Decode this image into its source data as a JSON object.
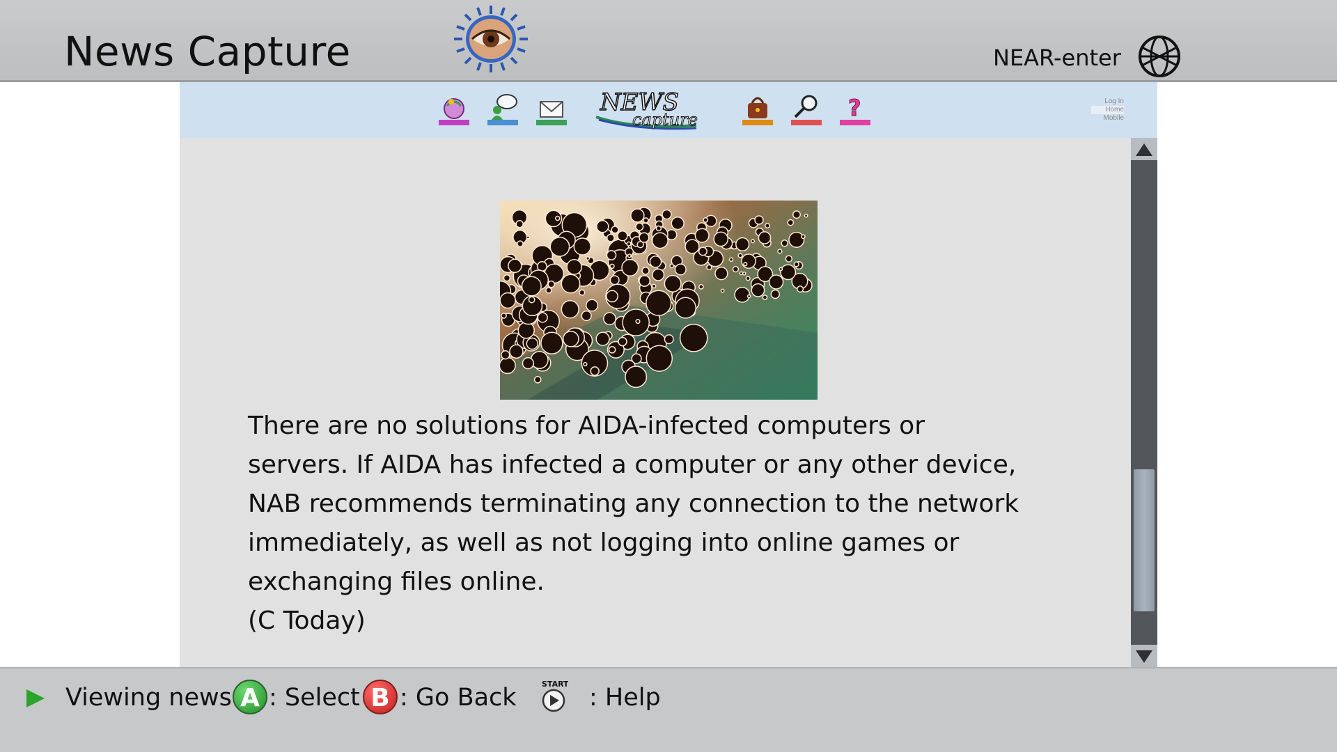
{
  "header": {
    "app_title": "News Capture",
    "mode_label": "NEAR-enter"
  },
  "toolbar": {
    "buttons": [
      {
        "name": "globe-person-icon",
        "color": "#c040c0"
      },
      {
        "name": "chat-icon",
        "color": "#4a8fd0"
      },
      {
        "name": "mail-icon",
        "color": "#3aa05a"
      },
      {
        "name": "bag-icon",
        "color": "#e08a10"
      },
      {
        "name": "search-icon",
        "color": "#e05050"
      },
      {
        "name": "help-icon",
        "color": "#e040a0"
      }
    ],
    "site_logo_top": "NEWS",
    "site_logo_bottom": "capture",
    "mini_links": [
      "Log In",
      "Home",
      "Mobile"
    ]
  },
  "article": {
    "lines": [
      "There are no solutions for AIDA-infected computers or",
      "servers. If AIDA has infected a computer or any other device,",
      "NAB recommends terminating any connection to the network",
      "immediately, as well as not logging into online games or",
      "exchanging files online.",
      "(C Today)"
    ]
  },
  "scrollbar": {
    "position_fraction": 0.75
  },
  "status_bar": {
    "message": "Viewing news.",
    "a_button": "A",
    "a_action": ": Select",
    "b_button": "B",
    "b_action": ": Go Back",
    "start_label": "START",
    "help_action": ": Help"
  }
}
